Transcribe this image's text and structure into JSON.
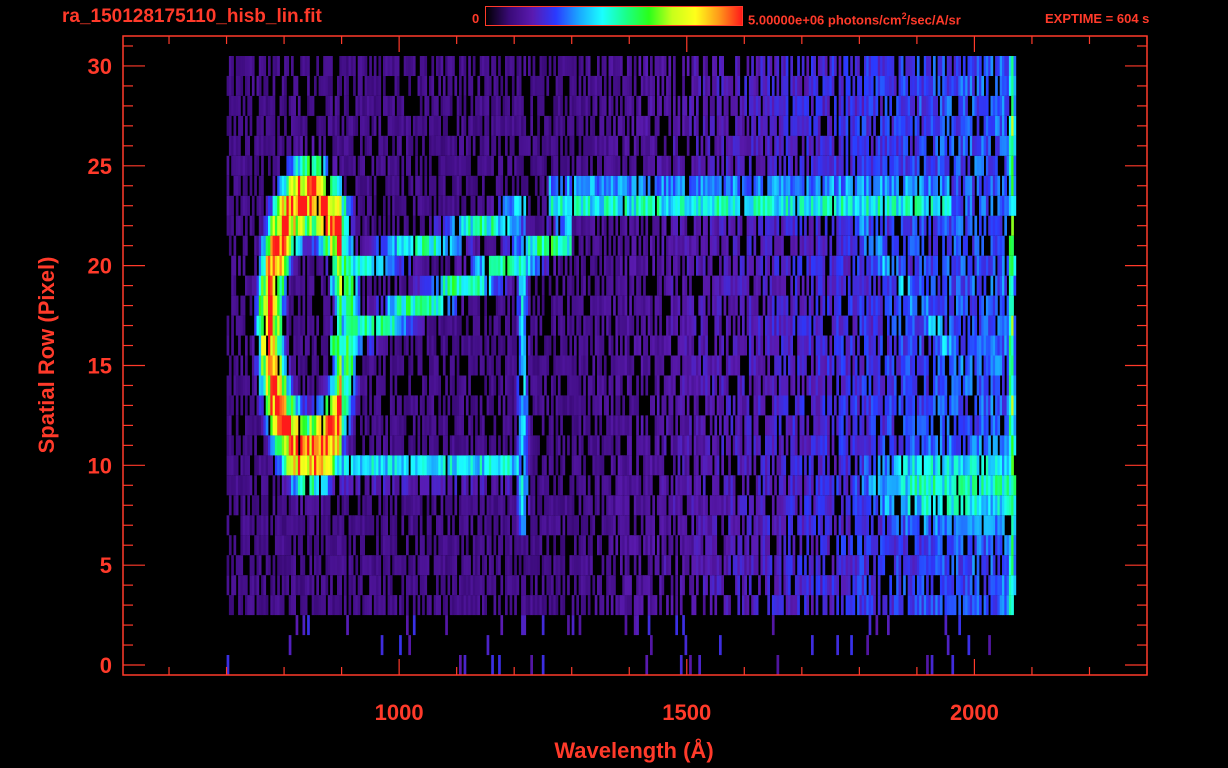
{
  "header": {
    "filename": "ra_150128175110_hisb_lin.fit",
    "colorbar_min": "0",
    "colorbar_max": "5.00000e+06 photons/cm",
    "colorbar_max_sup": "2",
    "colorbar_units_tail": "/sec/A/sr",
    "exptime": "EXPTIME = 604 s"
  },
  "colors": {
    "axis": "#ff3a2a",
    "background": "#000000",
    "colormap": [
      "#000000",
      "#3a0a78",
      "#5a1ab0",
      "#2a3aff",
      "#1aa8ff",
      "#1affff",
      "#1aff8a",
      "#2aff1a",
      "#c8ff1a",
      "#ffff1a",
      "#ff9a1a",
      "#ff1a1a"
    ]
  },
  "chart_data": {
    "type": "heatmap",
    "title": "",
    "xlabel": "Wavelength (Å)",
    "ylabel": "Spatial Row (Pixel)",
    "xlim": [
      520,
      2300
    ],
    "ylim": [
      -0.5,
      31.5
    ],
    "x_ticks": [
      1000,
      1500,
      2000
    ],
    "y_ticks": [
      0,
      5,
      10,
      15,
      20,
      25,
      30
    ],
    "x_minor_step": 100,
    "y_minor_step": 1,
    "colorbar_range": [
      0,
      5000000
    ],
    "colorbar_units": "photons/cm^2/sec/A/sr",
    "grid": false,
    "data_extent": {
      "x": [
        700,
        2070
      ],
      "rows": [
        0,
        30
      ]
    },
    "features": [
      {
        "name": "bright arc",
        "x_center": 830,
        "rows": [
          10,
          24
        ],
        "peak_intensity": 1.0
      },
      {
        "name": "bright blob",
        "x": 880,
        "row": 22.5,
        "peak_intensity": 0.95
      },
      {
        "name": "bright blob",
        "x": 860,
        "row": 11.5,
        "peak_intensity": 0.9
      },
      {
        "name": "diagonal band",
        "x": [
          900,
          1300
        ],
        "rows": [
          19,
          22.5
        ],
        "peak_intensity": 0.55
      },
      {
        "name": "upper band",
        "x": [
          1280,
          2000
        ],
        "rows": [
          22.5,
          24.5
        ],
        "peak_intensity": 0.5
      },
      {
        "name": "vertical line",
        "x": 1215,
        "rows": [
          6,
          21
        ],
        "peak_intensity": 0.4
      },
      {
        "name": "lower right region",
        "x": [
          1750,
          2060
        ],
        "rows": [
          6,
          12
        ],
        "peak_intensity": 0.5
      },
      {
        "name": "edge line",
        "x": 2065,
        "rows": [
          1,
          30
        ],
        "peak_intensity": 0.6
      }
    ]
  }
}
